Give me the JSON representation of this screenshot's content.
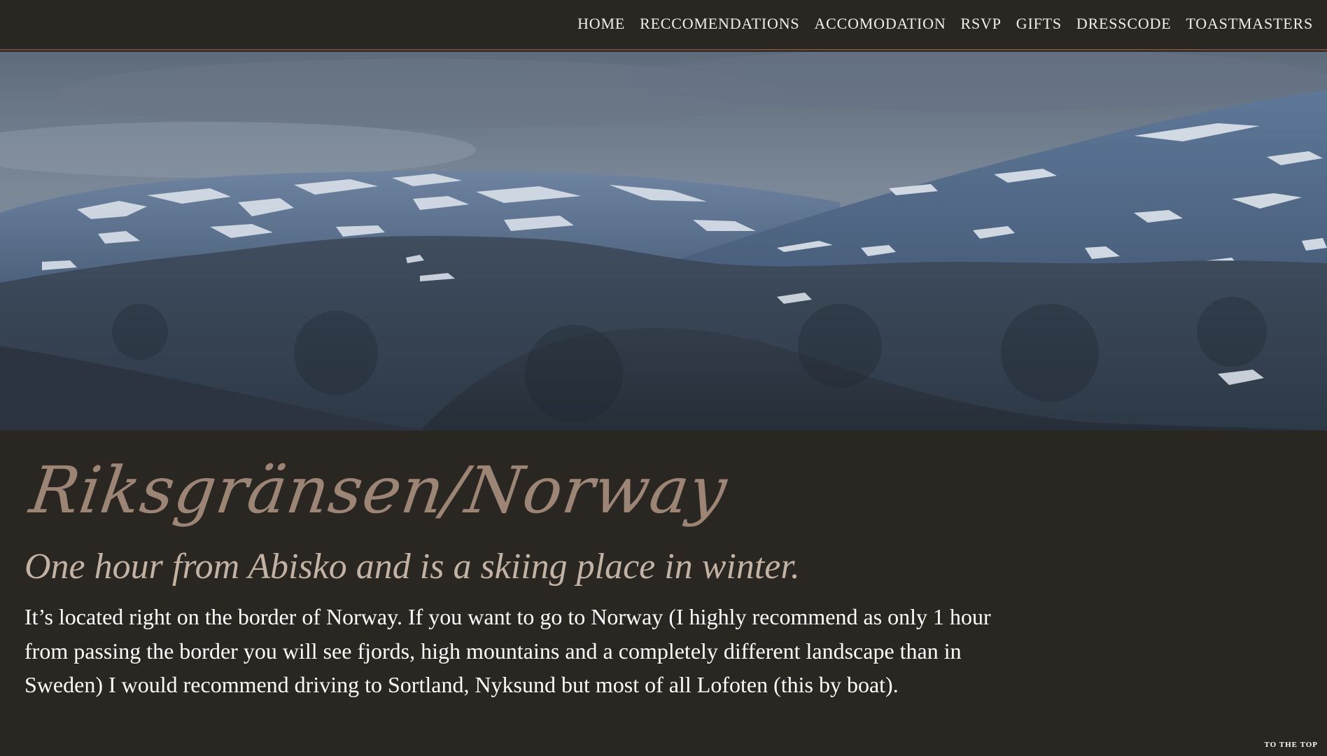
{
  "nav": {
    "items": [
      {
        "label": "HOME"
      },
      {
        "label": "RECCOMENDATIONS"
      },
      {
        "label": "ACCOMODATION"
      },
      {
        "label": "RSVP"
      },
      {
        "label": "GIFTS"
      },
      {
        "label": "DRESSCODE"
      },
      {
        "label": "TOASTMASTERS"
      }
    ]
  },
  "hero": {
    "description": "snowy mountain landscape"
  },
  "content": {
    "title": "Riksgränsen/Norway",
    "subtitle": "One hour from Abisko and is a skiing place in winter.",
    "body": "It’s located right on the border of Norway. If you want to go to Norway (I highly recommend as only 1 hour from passing the border you will see fjords, high mountains and a completely different landscape than in Sweden) I would recommend driving to Sortland, Nyksund but most of all Lofoten (this by boat)."
  },
  "footer": {
    "to_top_label": "TO THE TOP"
  },
  "colors": {
    "background": "#2a2621",
    "accent_border": "#6e4b3c",
    "title": "#9d8576",
    "subtitle": "#c2b3a4",
    "text": "#ffffff"
  }
}
